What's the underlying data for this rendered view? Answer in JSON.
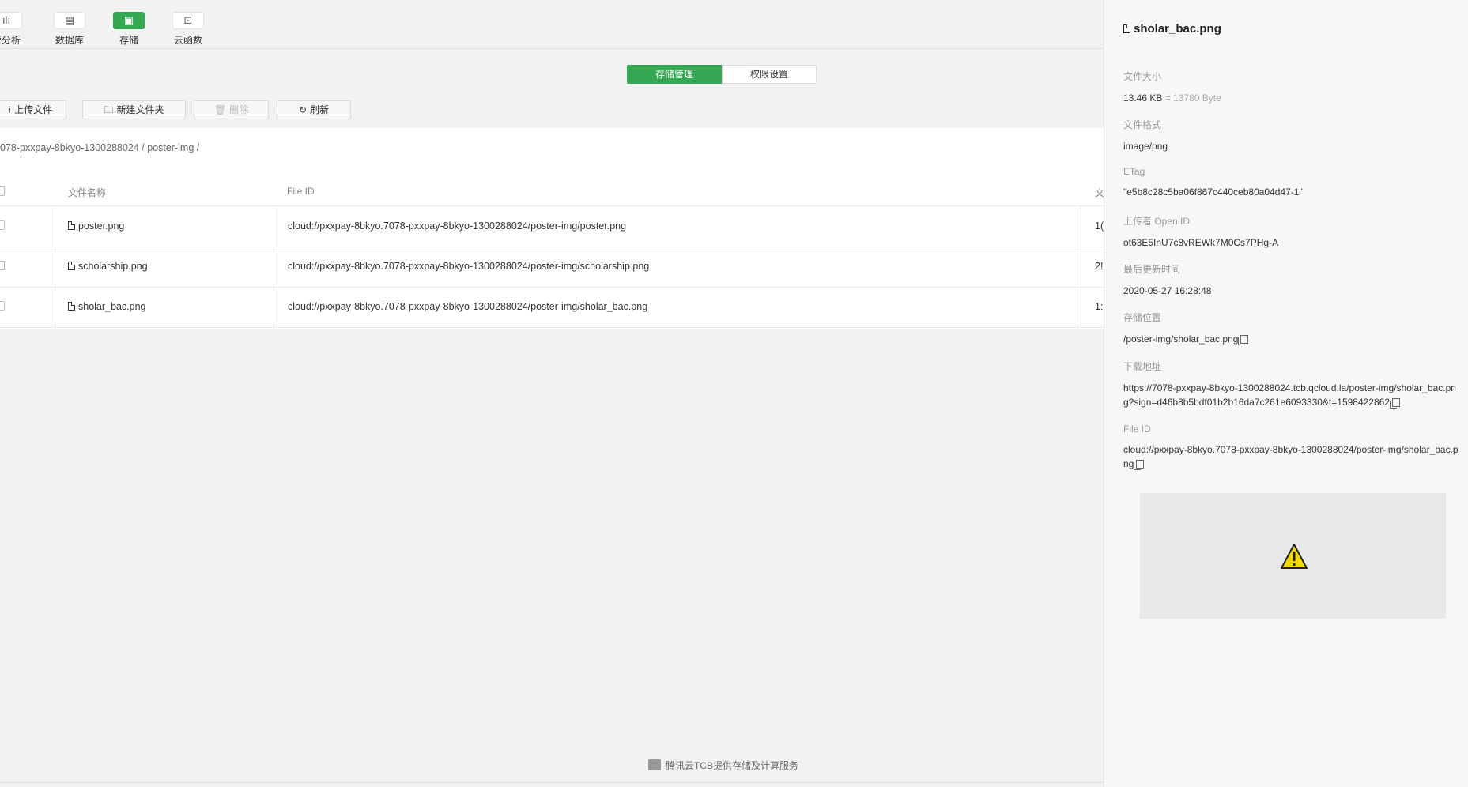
{
  "nav": {
    "items": [
      {
        "label": "营分析",
        "icon": "bar-chart-icon",
        "glyph": "ılı"
      },
      {
        "label": "数据库",
        "icon": "database-icon",
        "glyph": "▤"
      },
      {
        "label": "存储",
        "icon": "storage-icon",
        "glyph": "▣",
        "active": true
      },
      {
        "label": "云函数",
        "icon": "function-icon",
        "glyph": "⊡"
      }
    ]
  },
  "tabs": {
    "storage": "存储管理",
    "permissions": "权限设置"
  },
  "toolbar": {
    "upload": "上传文件",
    "new_folder": "新建文件夹",
    "delete": "删除",
    "refresh": "刷新"
  },
  "breadcrumb": "078-pxxpay-8bkyo-1300288024 / poster-img /",
  "table": {
    "headers": [
      "文件名称",
      "File ID",
      "文"
    ],
    "rows": [
      {
        "name": "poster.png",
        "file_id": "cloud://pxxpay-8bkyo.7078-pxxpay-8bkyo-1300288024/poster-img/poster.png",
        "extra": "1("
      },
      {
        "name": "scholarship.png",
        "file_id": "cloud://pxxpay-8bkyo.7078-pxxpay-8bkyo-1300288024/poster-img/scholarship.png",
        "extra": "2!"
      },
      {
        "name": "sholar_bac.png",
        "file_id": "cloud://pxxpay-8bkyo.7078-pxxpay-8bkyo-1300288024/poster-img/sholar_bac.png",
        "extra": "1:"
      }
    ]
  },
  "footer": "腾讯云TCB提供存储及计算服务",
  "panel": {
    "title": "sholar_bac.png",
    "size_label": "文件大小",
    "size_value": "13.46 KB",
    "size_bytes": "= 13780 Byte",
    "format_label": "文件格式",
    "format_value": "image/png",
    "etag_label": "ETag",
    "etag_value": "\"e5b8c28c5ba06f867c440ceb80a04d47-1\"",
    "uploader_label": "上传者 Open ID",
    "uploader_value": "ot63E5InU7c8vREWk7M0Cs7PHg-A",
    "updated_label": "最后更新时间",
    "updated_value": "2020-05-27 16:28:48",
    "location_label": "存储位置",
    "location_value": "/poster-img/sholar_bac.png",
    "download_label": "下载地址",
    "download_value": "https://7078-pxxpay-8bkyo-1300288024.tcb.qcloud.la/poster-img/sholar_bac.png?sign=d46b8b5bdf01b2b16da7c261e6093330&t=1598422862",
    "fileid_label": "File ID",
    "fileid_value": "cloud://pxxpay-8bkyo.7078-pxxpay-8bkyo-1300288024/poster-img/sholar_bac.png"
  }
}
